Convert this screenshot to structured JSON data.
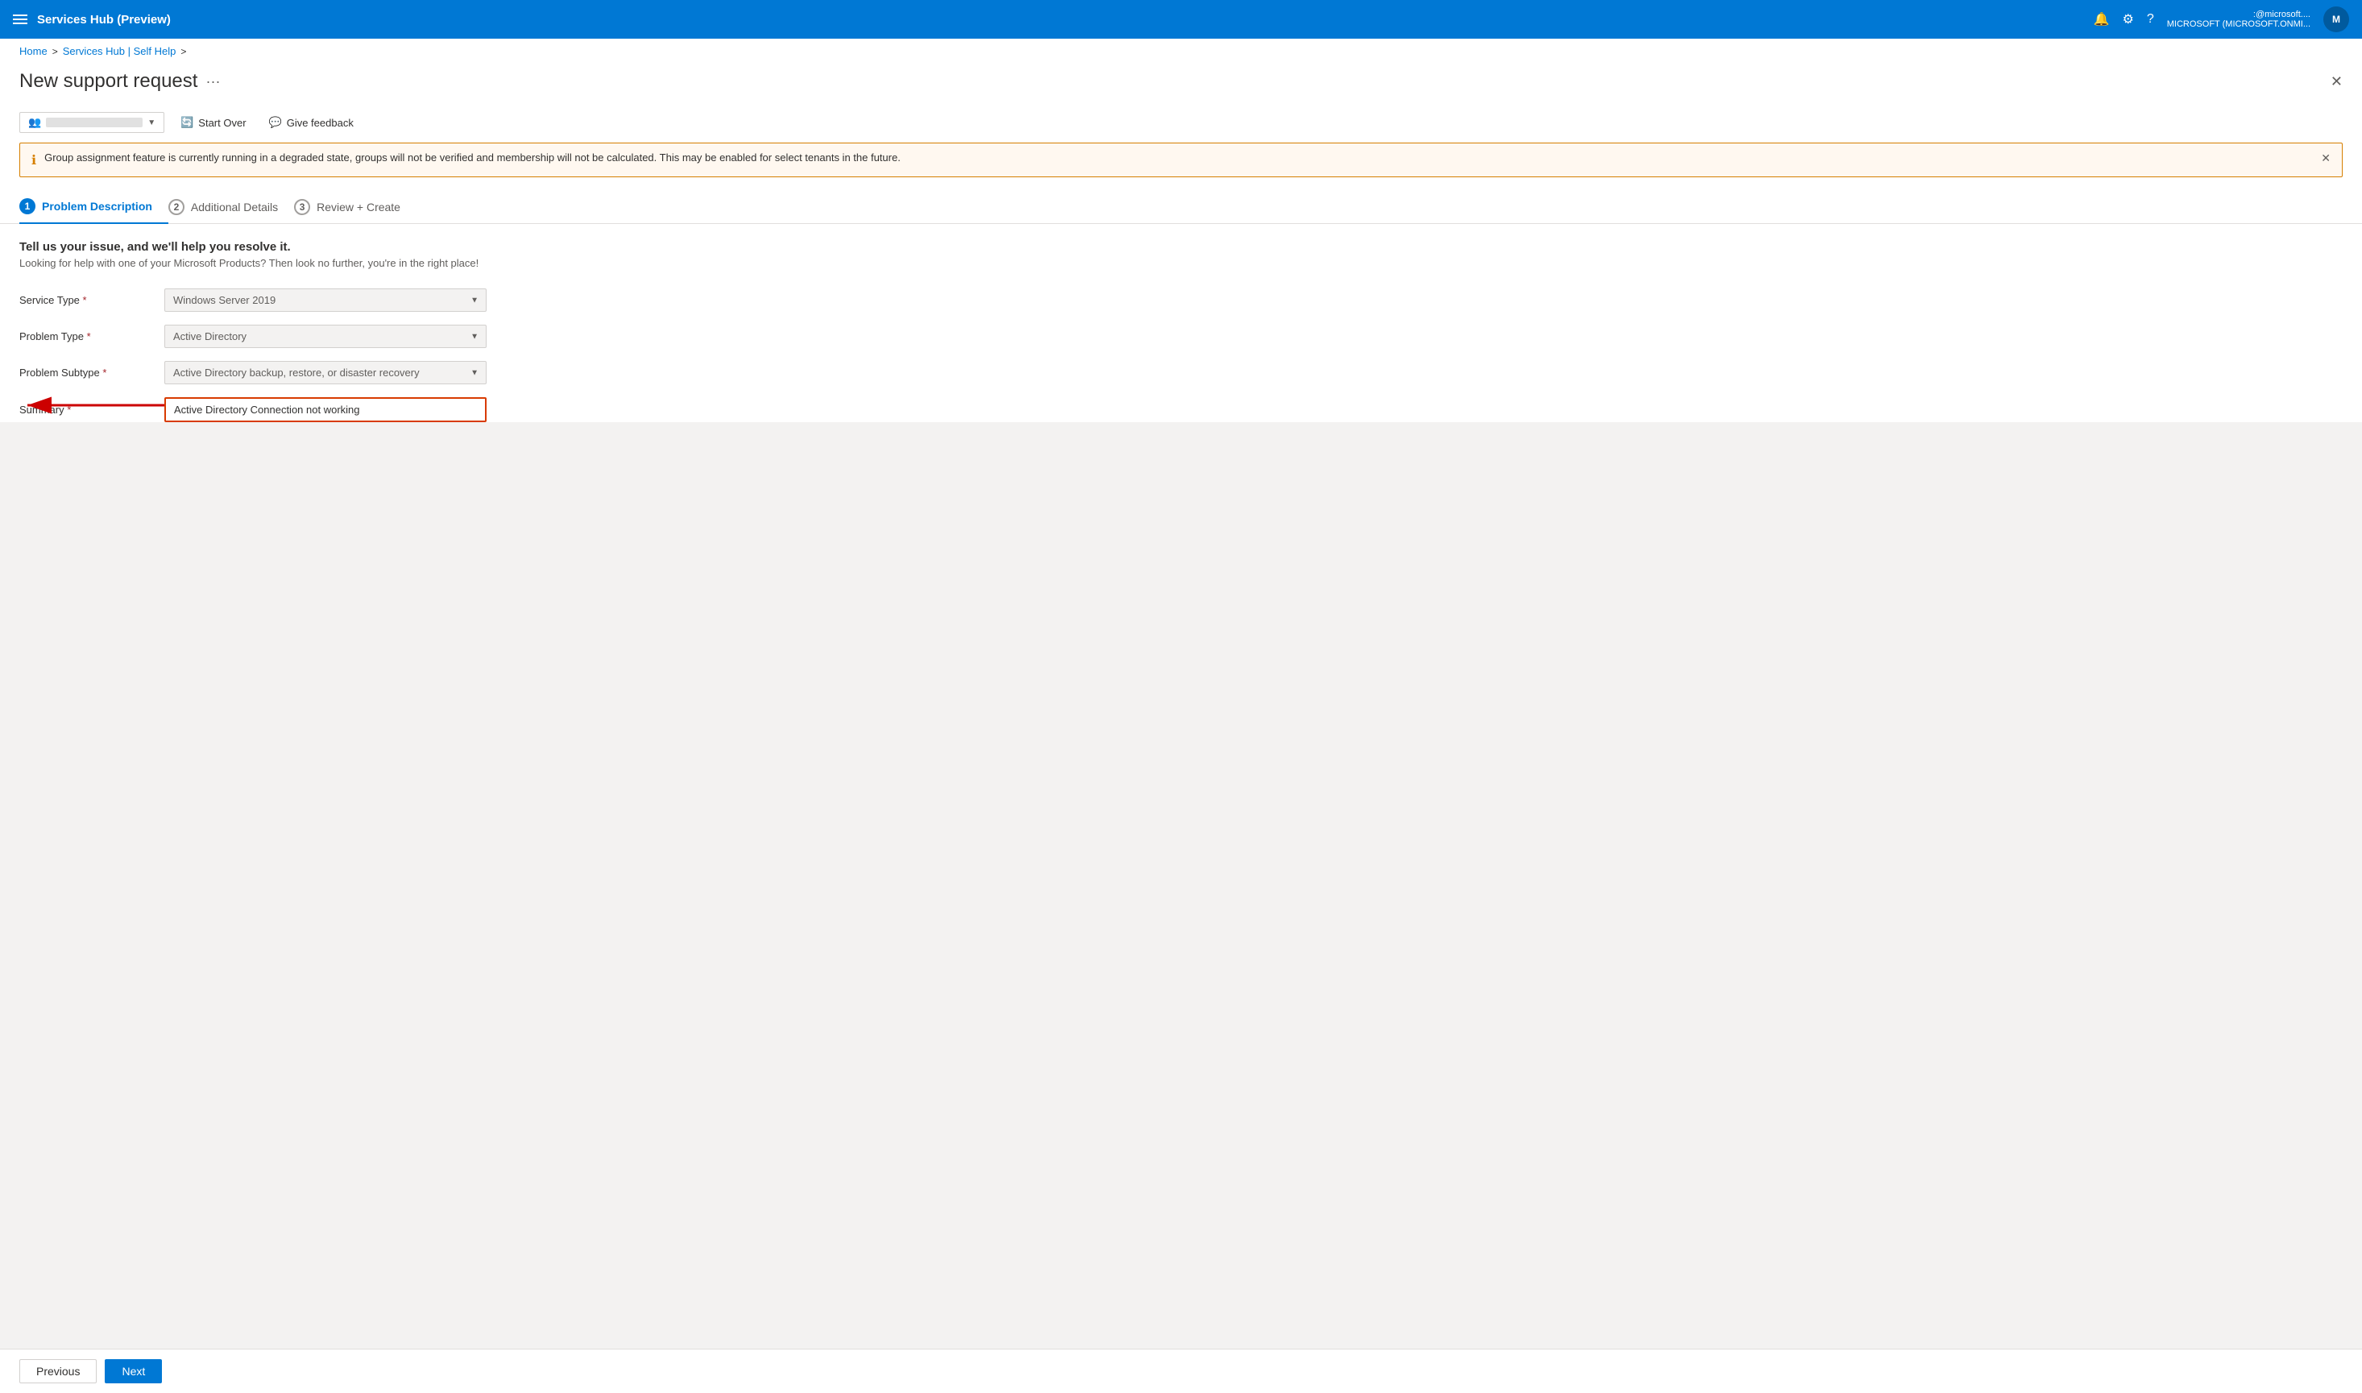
{
  "topbar": {
    "title": "Services Hub (Preview)",
    "user_name": ":@microsoft....",
    "user_sub": "MICROSOFT (MICROSOFT.ONMI..."
  },
  "breadcrumb": {
    "home": "Home",
    "sep1": ">",
    "self_help": "Services Hub | Self Help",
    "sep2": ">"
  },
  "page": {
    "title": "New support request",
    "more_label": "···"
  },
  "toolbar": {
    "start_over": "Start Over",
    "give_feedback": "Give feedback"
  },
  "warning": {
    "text": "Group assignment feature is currently running in a degraded state, groups will not be verified and membership will not be calculated. This may be enabled for select tenants in the future."
  },
  "steps": [
    {
      "num": "1",
      "label": "Problem Description",
      "active": true
    },
    {
      "num": "2",
      "label": "Additional Details",
      "active": false
    },
    {
      "num": "3",
      "label": "Review + Create",
      "active": false
    }
  ],
  "form": {
    "intro_title": "Tell us your issue, and we'll help you resolve it.",
    "intro_sub": "Looking for help with one of your Microsoft Products? Then look no further, you're in the right place!",
    "service_type_label": "Service Type",
    "service_type_value": "Windows Server 2019",
    "problem_type_label": "Problem Type",
    "problem_type_value": "Active Directory",
    "problem_subtype_label": "Problem Subtype",
    "problem_subtype_value": "Active Directory backup, restore, or disaster recovery",
    "summary_label": "Summary",
    "summary_value": "Active Directory Connection not working"
  },
  "bottom": {
    "previous": "Previous",
    "next": "Next"
  }
}
